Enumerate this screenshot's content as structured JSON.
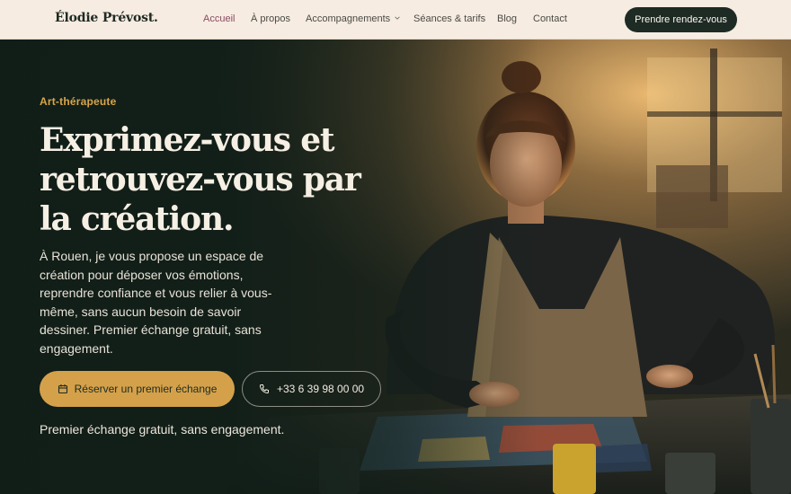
{
  "brand": {
    "name": "Élodie Prévost."
  },
  "nav": {
    "items": [
      {
        "label": "Accueil",
        "active": true
      },
      {
        "label": "À propos"
      },
      {
        "label": "Accompagnements",
        "has_dropdown": true
      },
      {
        "label": "Séances & tarifs"
      },
      {
        "label": "Blog"
      },
      {
        "label": "Contact"
      }
    ],
    "cta_label": "Prendre rendez-vous"
  },
  "hero": {
    "eyebrow": "Art-thérapeute",
    "title": "Exprimez-vous et retrouvez-vous par la création.",
    "lead": "À Rouen, je vous propose un espace de création pour déposer vos émotions, reprendre confiance et vous relier à vous-même, sans aucun besoin de savoir dessiner. Premier échange gratuit, sans engagement.",
    "primary_button": {
      "label": "Réserver un premier échange",
      "icon": "calendar-icon"
    },
    "secondary_button": {
      "label": "+33 6 39 98 00 00",
      "icon": "phone-icon"
    },
    "note": "Premier échange gratuit, sans engagement.",
    "image_subject": "art-therapist-at-work-photo"
  },
  "colors": {
    "header_bg": "#f6ece1",
    "dark": "#1d2b24",
    "accent_gold": "#d4a14a",
    "active_nav": "#8a4a63"
  }
}
